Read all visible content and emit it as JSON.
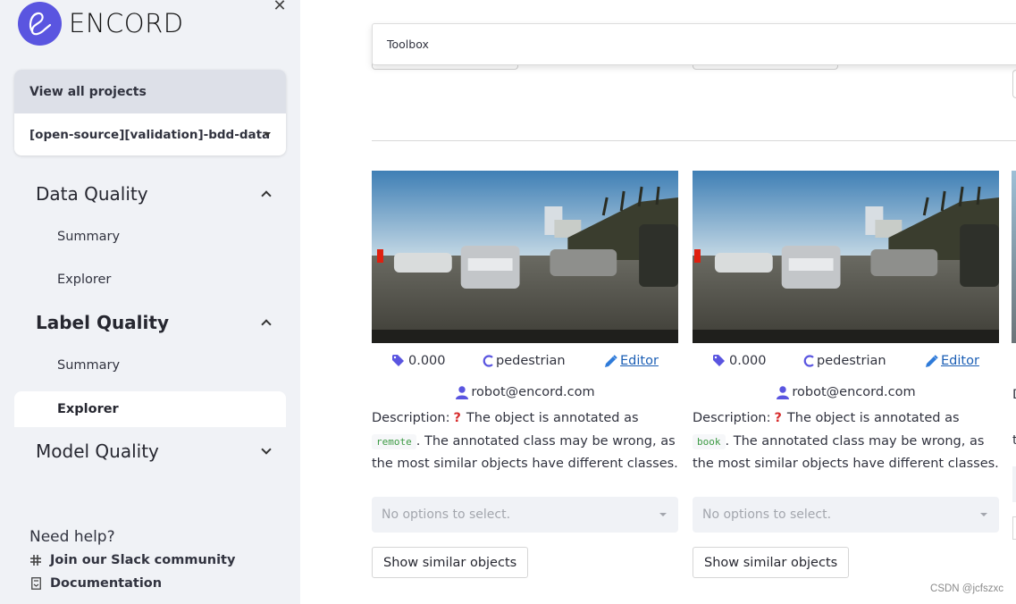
{
  "sidebar": {
    "brand": "ENCORD",
    "view_all_label": "View all projects",
    "project_select_value": "[open-source][validation]-bdd-data",
    "sections": [
      {
        "label": "Data Quality",
        "expanded": true,
        "items": [
          "Summary",
          "Explorer"
        ]
      },
      {
        "label": "Label Quality",
        "expanded": true,
        "items": [
          "Summary",
          "Explorer"
        ],
        "active_item": "Explorer"
      },
      {
        "label": "Model Quality",
        "expanded": false,
        "items": []
      }
    ],
    "help": {
      "title": "Need help?",
      "links": [
        {
          "icon": "slack-icon",
          "label": "Join our Slack community"
        },
        {
          "icon": "book-icon",
          "label": "Documentation"
        }
      ]
    }
  },
  "main": {
    "toolbox_label": "Toolbox",
    "cards": [
      {
        "score": "0.000",
        "class_name": "pedestrian",
        "editor_label": "Editor",
        "annotator": "robot@encord.com",
        "description_prefix": "Description:",
        "description_pre": "The object is annotated as",
        "annotated_class": "remote",
        "description_post": ". The annotated class may be wrong, as the most similar objects have different classes.",
        "select_placeholder": "No options to select.",
        "similar_button": "Show similar objects"
      },
      {
        "score": "0.000",
        "class_name": "pedestrian",
        "editor_label": "Editor",
        "annotator": "robot@encord.com",
        "description_prefix": "Description:",
        "description_pre": "The object is annotated as",
        "annotated_class": "book",
        "description_post": ". The annotated class may be wrong, as the most similar objects have different classes.",
        "select_placeholder": "No options to select.",
        "similar_button": "Show similar objects"
      }
    ],
    "peek": {
      "text1": "D",
      "text2": "t"
    }
  },
  "colors": {
    "accent": "#5a55e0",
    "link": "#1c5fb5",
    "sidebar_bg": "#f0f2f6",
    "code_green": "#3c9a43",
    "question_red": "#d72e2e"
  },
  "watermark": "CSDN @jcfszxc"
}
